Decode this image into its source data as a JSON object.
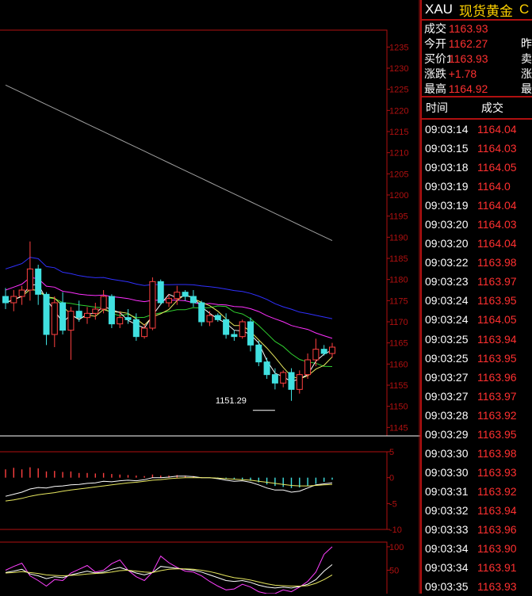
{
  "chart_data": {
    "type": "candlestick",
    "symbol_panel": {
      "symbol": "XAU",
      "name": "现货黄金",
      "name_overflow": "C",
      "quotes": [
        {
          "label": "成交",
          "value": "1163.93",
          "extra": ""
        },
        {
          "label": "今开",
          "value": "1162.27",
          "extra": "昨"
        },
        {
          "label": "买价1",
          "value": "1163.93",
          "extra": "卖"
        },
        {
          "label": "涨跌",
          "value": "+1.78",
          "extra": "涨"
        },
        {
          "label": "最高",
          "value": "1164.92",
          "extra": "最"
        }
      ],
      "ticks_header": {
        "time": "时间",
        "price": "成交"
      },
      "ticks": [
        {
          "time": "09:03:14",
          "price": "1164.04"
        },
        {
          "time": "09:03:15",
          "price": "1164.03"
        },
        {
          "time": "09:03:18",
          "price": "1164.05"
        },
        {
          "time": "09:03:19",
          "price": "1164.0"
        },
        {
          "time": "09:03:19",
          "price": "1164.04"
        },
        {
          "time": "09:03:20",
          "price": "1164.03"
        },
        {
          "time": "09:03:20",
          "price": "1164.04"
        },
        {
          "time": "09:03:22",
          "price": "1163.98"
        },
        {
          "time": "09:03:23",
          "price": "1163.97"
        },
        {
          "time": "09:03:24",
          "price": "1163.95"
        },
        {
          "time": "09:03:24",
          "price": "1164.05"
        },
        {
          "time": "09:03:25",
          "price": "1163.94"
        },
        {
          "time": "09:03:25",
          "price": "1163.95"
        },
        {
          "time": "09:03:27",
          "price": "1163.96"
        },
        {
          "time": "09:03:27",
          "price": "1163.97"
        },
        {
          "time": "09:03:28",
          "price": "1163.92"
        },
        {
          "time": "09:03:29",
          "price": "1163.95"
        },
        {
          "time": "09:03:30",
          "price": "1163.98"
        },
        {
          "time": "09:03:30",
          "price": "1163.93"
        },
        {
          "time": "09:03:31",
          "price": "1163.92"
        },
        {
          "time": "09:03:32",
          "price": "1163.94"
        },
        {
          "time": "09:03:33",
          "price": "1163.96"
        },
        {
          "time": "09:03:34",
          "price": "1163.90"
        },
        {
          "time": "09:03:34",
          "price": "1163.91"
        },
        {
          "time": "09:03:35",
          "price": "1163.93"
        }
      ]
    },
    "price_axis": {
      "ticks": [
        1235,
        1230,
        1225,
        1220,
        1215,
        1210,
        1205,
        1200,
        1195,
        1190,
        1185,
        1180,
        1175,
        1170,
        1165,
        1160,
        1155,
        1150,
        1145
      ],
      "min": 1143,
      "max": 1239
    },
    "macd_axis": {
      "ticks": [
        5,
        0,
        -5,
        -10
      ],
      "min": -10,
      "max": 5
    },
    "osc_axis": {
      "ticks": [
        100,
        50
      ],
      "min": 0,
      "max": 110
    },
    "annotations": [
      {
        "text": "1151.29",
        "price": 1151.29,
        "bar_index": 33
      }
    ],
    "candles": [
      {
        "o": 1176.0,
        "h": 1178.0,
        "l": 1173.0,
        "c": 1174.5
      },
      {
        "o": 1174.5,
        "h": 1177.5,
        "l": 1172.5,
        "c": 1176.0
      },
      {
        "o": 1176.0,
        "h": 1178.5,
        "l": 1174.0,
        "c": 1177.5
      },
      {
        "o": 1177.5,
        "h": 1189.0,
        "l": 1175.0,
        "c": 1182.5
      },
      {
        "o": 1182.5,
        "h": 1183.5,
        "l": 1174.0,
        "c": 1176.5
      },
      {
        "o": 1176.5,
        "h": 1177.0,
        "l": 1164.5,
        "c": 1167.0
      },
      {
        "o": 1167.0,
        "h": 1176.0,
        "l": 1164.0,
        "c": 1174.5
      },
      {
        "o": 1174.5,
        "h": 1177.0,
        "l": 1167.0,
        "c": 1168.0
      },
      {
        "o": 1168.0,
        "h": 1173.5,
        "l": 1161.0,
        "c": 1172.5
      },
      {
        "o": 1172.5,
        "h": 1175.0,
        "l": 1170.0,
        "c": 1171.0
      },
      {
        "o": 1171.0,
        "h": 1173.5,
        "l": 1169.5,
        "c": 1172.0
      },
      {
        "o": 1172.0,
        "h": 1174.5,
        "l": 1170.5,
        "c": 1173.0
      },
      {
        "o": 1173.0,
        "h": 1177.5,
        "l": 1172.0,
        "c": 1176.0
      },
      {
        "o": 1176.0,
        "h": 1176.5,
        "l": 1168.5,
        "c": 1169.5
      },
      {
        "o": 1169.5,
        "h": 1172.5,
        "l": 1168.5,
        "c": 1171.0
      },
      {
        "o": 1171.0,
        "h": 1173.0,
        "l": 1169.5,
        "c": 1170.5
      },
      {
        "o": 1170.5,
        "h": 1172.0,
        "l": 1165.5,
        "c": 1166.5
      },
      {
        "o": 1166.5,
        "h": 1169.5,
        "l": 1166.0,
        "c": 1168.5
      },
      {
        "o": 1168.5,
        "h": 1180.5,
        "l": 1168.0,
        "c": 1179.5
      },
      {
        "o": 1179.5,
        "h": 1180.0,
        "l": 1174.0,
        "c": 1174.5
      },
      {
        "o": 1174.5,
        "h": 1176.5,
        "l": 1173.5,
        "c": 1175.5
      },
      {
        "o": 1175.5,
        "h": 1178.5,
        "l": 1174.0,
        "c": 1177.0
      },
      {
        "o": 1177.0,
        "h": 1177.5,
        "l": 1175.0,
        "c": 1176.0
      },
      {
        "o": 1176.0,
        "h": 1177.5,
        "l": 1173.5,
        "c": 1174.5
      },
      {
        "o": 1174.5,
        "h": 1175.0,
        "l": 1169.0,
        "c": 1170.0
      },
      {
        "o": 1170.0,
        "h": 1172.5,
        "l": 1169.0,
        "c": 1171.5
      },
      {
        "o": 1171.5,
        "h": 1172.0,
        "l": 1170.0,
        "c": 1170.5
      },
      {
        "o": 1170.5,
        "h": 1172.0,
        "l": 1166.0,
        "c": 1167.0
      },
      {
        "o": 1167.0,
        "h": 1168.0,
        "l": 1165.5,
        "c": 1166.5
      },
      {
        "o": 1166.5,
        "h": 1170.5,
        "l": 1166.0,
        "c": 1170.0
      },
      {
        "o": 1170.0,
        "h": 1171.0,
        "l": 1163.0,
        "c": 1164.5
      },
      {
        "o": 1164.5,
        "h": 1165.5,
        "l": 1159.5,
        "c": 1160.5
      },
      {
        "o": 1160.5,
        "h": 1161.5,
        "l": 1156.5,
        "c": 1157.5
      },
      {
        "o": 1157.5,
        "h": 1159.0,
        "l": 1154.0,
        "c": 1155.5
      },
      {
        "o": 1155.5,
        "h": 1158.5,
        "l": 1154.5,
        "c": 1158.0
      },
      {
        "o": 1158.0,
        "h": 1159.0,
        "l": 1151.3,
        "c": 1154.0
      },
      {
        "o": 1154.0,
        "h": 1158.5,
        "l": 1153.0,
        "c": 1157.5
      },
      {
        "o": 1157.5,
        "h": 1162.5,
        "l": 1156.5,
        "c": 1161.0
      },
      {
        "o": 1161.0,
        "h": 1166.0,
        "l": 1159.5,
        "c": 1163.5
      },
      {
        "o": 1163.5,
        "h": 1164.5,
        "l": 1162.0,
        "c": 1162.5
      },
      {
        "o": 1162.5,
        "h": 1165.0,
        "l": 1161.5,
        "c": 1164.0
      }
    ],
    "macd_hist": [
      1.6,
      1.9,
      1.6,
      2.0,
      1.8,
      1.2,
      1.3,
      1.1,
      1.2,
      0.9,
      0.9,
      0.8,
      0.9,
      0.7,
      0.6,
      0.5,
      0.4,
      0.3,
      0.6,
      0.4,
      0.4,
      0.5,
      0.4,
      0.3,
      0.1,
      0.0,
      -0.1,
      -0.2,
      -0.3,
      -0.4,
      -0.6,
      -0.9,
      -1.3,
      -1.6,
      -1.8,
      -2.0,
      -1.9,
      -1.6,
      -1.2,
      -0.8,
      -0.4
    ],
    "macd_dif": [
      -3.6,
      -3.2,
      -2.8,
      -2.2,
      -1.9,
      -2.0,
      -1.7,
      -1.6,
      -1.4,
      -1.3,
      -1.1,
      -1.0,
      -0.7,
      -0.8,
      -0.6,
      -0.5,
      -0.6,
      -0.4,
      0.0,
      0.0,
      0.1,
      0.3,
      0.3,
      0.2,
      0.0,
      0.0,
      -0.2,
      -0.5,
      -0.7,
      -0.6,
      -0.9,
      -1.4,
      -2.0,
      -2.4,
      -2.4,
      -2.8,
      -2.6,
      -2.0,
      -1.4,
      -1.2,
      -1.0
    ],
    "macd_dea": [
      -4.5,
      -4.3,
      -4.0,
      -3.6,
      -3.3,
      -3.1,
      -2.9,
      -2.6,
      -2.4,
      -2.2,
      -2.0,
      -1.8,
      -1.6,
      -1.4,
      -1.2,
      -1.0,
      -0.9,
      -0.7,
      -0.5,
      -0.4,
      -0.2,
      -0.1,
      0.0,
      0.0,
      0.0,
      0.0,
      -0.1,
      -0.2,
      -0.3,
      -0.4,
      -0.5,
      -0.7,
      -0.9,
      -1.1,
      -1.3,
      -1.5,
      -1.6,
      -1.6,
      -1.5,
      -1.4,
      -1.3
    ],
    "osc_k": [
      45,
      48,
      52,
      42,
      38,
      32,
      36,
      34,
      40,
      44,
      48,
      44,
      46,
      52,
      56,
      50,
      44,
      40,
      45,
      58,
      56,
      54,
      52,
      50,
      46,
      40,
      34,
      28,
      26,
      28,
      24,
      18,
      14,
      12,
      14,
      12,
      15,
      20,
      30,
      48,
      62
    ],
    "osc_d": [
      44,
      45,
      47,
      45,
      43,
      40,
      39,
      38,
      39,
      40,
      42,
      43,
      44,
      46,
      49,
      50,
      48,
      46,
      45,
      49,
      52,
      53,
      53,
      52,
      50,
      47,
      43,
      38,
      34,
      32,
      29,
      25,
      21,
      18,
      17,
      16,
      16,
      17,
      22,
      30,
      40
    ],
    "osc_j": [
      50,
      58,
      65,
      38,
      28,
      16,
      30,
      28,
      44,
      52,
      60,
      46,
      50,
      64,
      72,
      50,
      36,
      28,
      46,
      80,
      66,
      56,
      48,
      46,
      38,
      26,
      16,
      8,
      10,
      20,
      14,
      4,
      0,
      0,
      8,
      4,
      14,
      26,
      46,
      84,
      100
    ]
  }
}
